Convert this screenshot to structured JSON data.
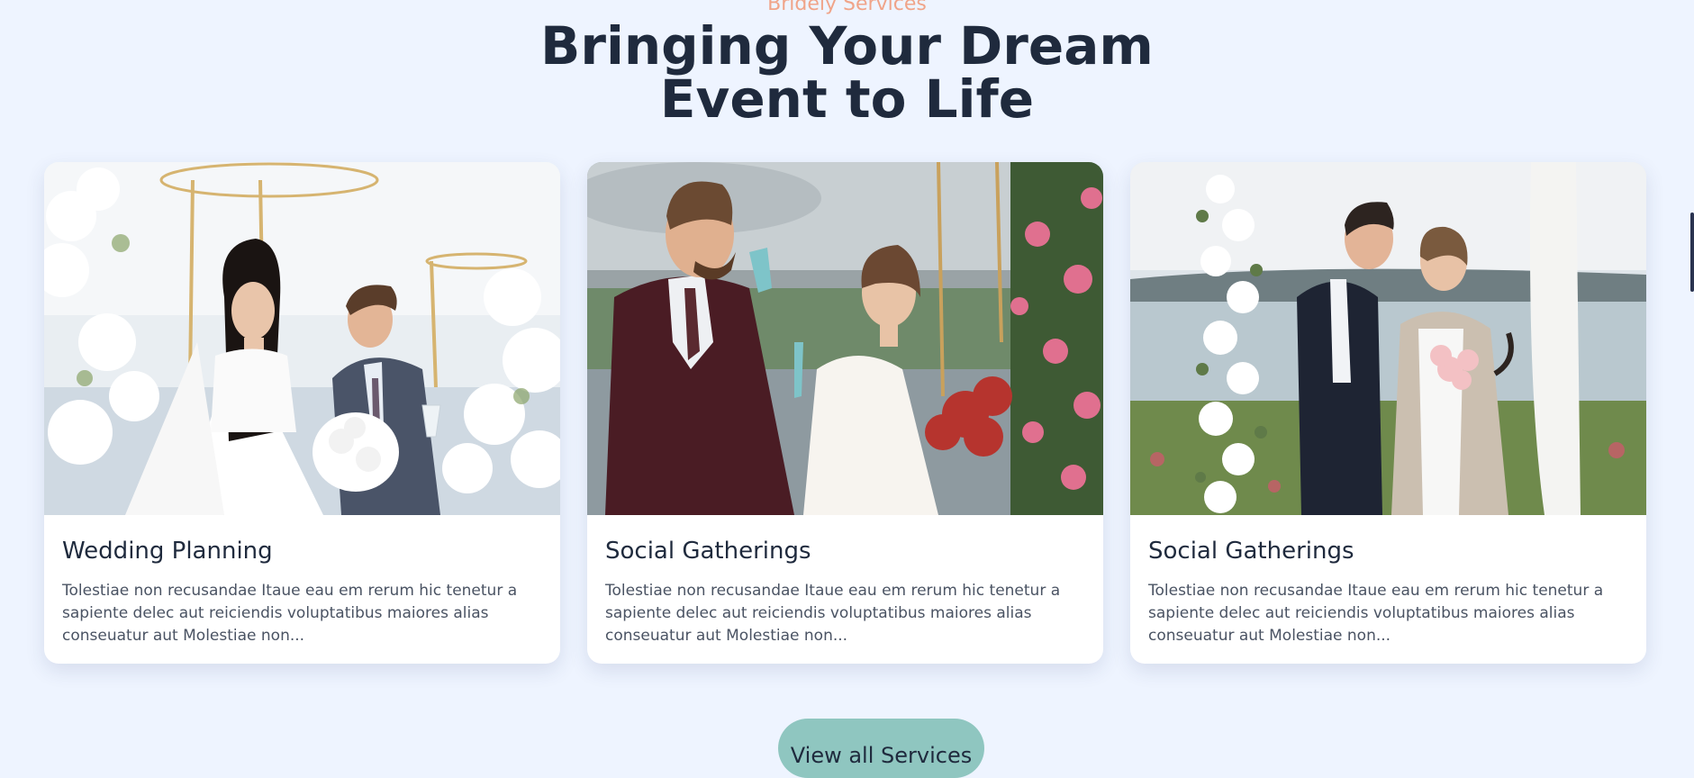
{
  "section": {
    "eyebrow": "Bridely Services",
    "heading_line1": "Bringing Your Dream",
    "heading_line2": "Event to Life"
  },
  "cards": [
    {
      "title": "Wedding Planning",
      "description": "Tolestiae non recusandae Itaue eau em rerum hic tenetur a sapiente delec aut reiciendis voluptatibus maiores alias conseuatur aut Molestiae non...",
      "image": "wedding-couple-photo"
    },
    {
      "title": "Social Gatherings",
      "description": "Tolestiae non recusandae Itaue eau em rerum hic tenetur a sapiente delec aut reiciendis voluptatibus maiores alias conseuatur aut Molestiae non...",
      "image": "couple-toast-photo"
    },
    {
      "title": "Social Gatherings",
      "description": "Tolestiae non recusandae Itaue eau em rerum hic tenetur a sapiente delec aut reiciendis voluptatibus maiores alias conseuatur aut Molestiae non...",
      "image": "couple-by-lake-photo"
    }
  ],
  "cta": {
    "label": "View all Services"
  },
  "colors": {
    "background": "#eef4ff",
    "accent": "#f0a489",
    "heading": "#1f2a3d",
    "button": "#8fc6c0"
  }
}
